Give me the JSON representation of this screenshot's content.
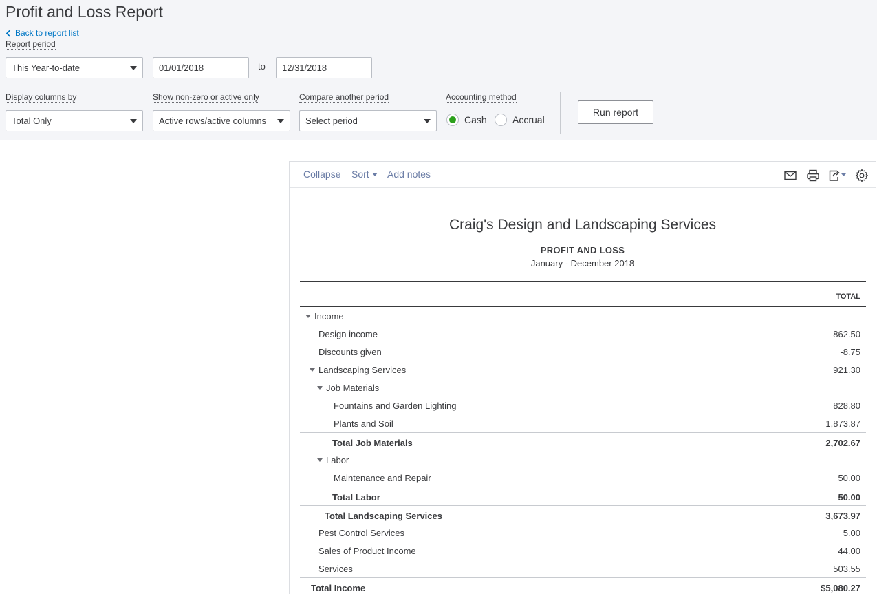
{
  "page": {
    "title": "Profit and Loss Report",
    "back_link": "Back to report list"
  },
  "filters": {
    "report_period_label": "Report period",
    "report_period_value": "This Year-to-date",
    "date_from": "01/01/2018",
    "to_label": "to",
    "date_to": "12/31/2018",
    "display_columns_label": "Display columns by",
    "display_columns_value": "Total Only",
    "nonzero_label": "Show non-zero or active only",
    "nonzero_value": "Active rows/active columns",
    "compare_label": "Compare another period",
    "compare_value": "Select period",
    "accounting_label": "Accounting method",
    "cash_label": "Cash",
    "accrual_label": "Accrual",
    "selected_method": "Cash",
    "run_button": "Run report"
  },
  "toolbar": {
    "collapse": "Collapse",
    "sort": "Sort",
    "add_notes": "Add notes",
    "icons": [
      "email-icon",
      "print-icon",
      "export-icon",
      "settings-icon"
    ]
  },
  "report": {
    "company": "Craig's Design and Landscaping Services",
    "title": "PROFIT AND LOSS",
    "period": "January - December 2018",
    "column_header": "TOTAL",
    "rows": [
      {
        "label": "Income",
        "amount": "",
        "collapsible": true,
        "total": false
      },
      {
        "label": "Design income",
        "amount": "862.50",
        "collapsible": false,
        "total": false
      },
      {
        "label": "Discounts given",
        "amount": "-8.75",
        "collapsible": false,
        "total": false
      },
      {
        "label": "Landscaping Services",
        "amount": "921.30",
        "collapsible": true,
        "total": false
      },
      {
        "label": "Job Materials",
        "amount": "",
        "collapsible": true,
        "total": false
      },
      {
        "label": "Fountains and Garden Lighting",
        "amount": "828.80",
        "collapsible": false,
        "total": false
      },
      {
        "label": "Plants and Soil",
        "amount": "1,873.87",
        "collapsible": false,
        "total": false
      },
      {
        "label": "Total Job Materials",
        "amount": "2,702.67",
        "collapsible": false,
        "total": true
      },
      {
        "label": "Labor",
        "amount": "",
        "collapsible": true,
        "total": false
      },
      {
        "label": "Maintenance and Repair",
        "amount": "50.00",
        "collapsible": false,
        "total": false
      },
      {
        "label": "Total Labor",
        "amount": "50.00",
        "collapsible": false,
        "total": true
      },
      {
        "label": "Total Landscaping Services",
        "amount": "3,673.97",
        "collapsible": false,
        "total": true
      },
      {
        "label": "Pest Control Services",
        "amount": "5.00",
        "collapsible": false,
        "total": false
      },
      {
        "label": "Sales of Product Income",
        "amount": "44.00",
        "collapsible": false,
        "total": false
      },
      {
        "label": "Services",
        "amount": "503.55",
        "collapsible": false,
        "total": false
      },
      {
        "label": "Total Income",
        "amount": "$5,080.27",
        "collapsible": false,
        "total": true
      }
    ]
  },
  "colors": {
    "accent_green": "#2ca01c",
    "link_blue": "#0077c5",
    "toolbar_link": "#6b7da6",
    "header_bg": "#f4f5f8"
  }
}
